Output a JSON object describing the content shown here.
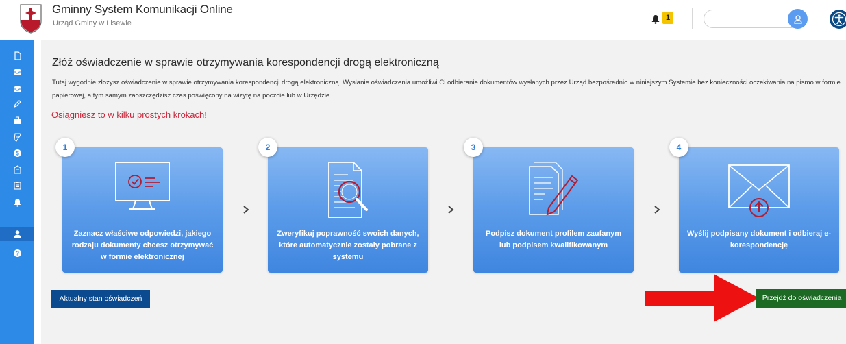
{
  "header": {
    "title": "Gminny System Komunikacji Online",
    "subtitle": "Urząd Gminy w Lisewie",
    "notification_count": "1",
    "search_value": "",
    "icons": [
      "coat-of-arms-logo",
      "bell-icon",
      "user-icon",
      "accessibility-icon"
    ]
  },
  "sidebar": {
    "items": [
      {
        "icon": "document-new-icon"
      },
      {
        "icon": "inbox-icon"
      },
      {
        "icon": "inbox-out-icon"
      },
      {
        "icon": "pencil-icon"
      },
      {
        "icon": "briefcase-icon"
      },
      {
        "icon": "receipt-icon"
      },
      {
        "icon": "coin-icon"
      },
      {
        "icon": "building-icon"
      },
      {
        "icon": "clipboard-icon"
      },
      {
        "icon": "bell-icon"
      },
      {
        "icon": "user-icon",
        "active": true
      },
      {
        "icon": "help-icon"
      }
    ]
  },
  "main": {
    "title": "Złóż oświadczenie w sprawie otrzymywania korespondencji drogą elektroniczną",
    "intro": "Tutaj wygodnie złożysz oświadczenie w sprawie otrzymywania korespondencji drogą elektroniczną. Wysłanie oświadczenia umożliwi Ci odbieranie dokumentów wysłanych przez Urząd bezpośrednio w niniejszym Systemie bez konieczności oczekiwania na pismo w formie papierowej, a tym samym zaoszczędzisz czas poświęcony na wizytę na poczcie lub w Urzędzie.",
    "highlight": "Osiągniesz to w kilku prostych krokach!",
    "steps": [
      {
        "number": "1",
        "icon": "monitor-checkmark-icon",
        "text": "Zaznacz właściwe odpowiedzi, jakiego rodzaju dokumenty chcesz otrzymywać w formie elektronicznej"
      },
      {
        "number": "2",
        "icon": "document-magnifier-icon",
        "text": "Zweryfikuj poprawność swoich danych, które automatycznie zostały pobrane z systemu"
      },
      {
        "number": "3",
        "icon": "document-pen-icon",
        "text": "Podpisz dokument profilem zaufanym lub podpisem kwalifikowanym"
      },
      {
        "number": "4",
        "icon": "envelope-upload-icon",
        "text": "Wyślij podpisany dokument i odbieraj e-korespondencję"
      }
    ],
    "status_button": "Aktualny stan oświadczeń",
    "go_button": "Przejdź do oświadczenia"
  },
  "colors": {
    "sidebar": "#2d8ae6",
    "card_top": "#87b8f3",
    "card_bottom": "#3f86e0",
    "accent_red": "#c8263a",
    "status_button": "#0b4a8f",
    "go_button": "#1c6a23",
    "arrow": "#ee1111"
  }
}
